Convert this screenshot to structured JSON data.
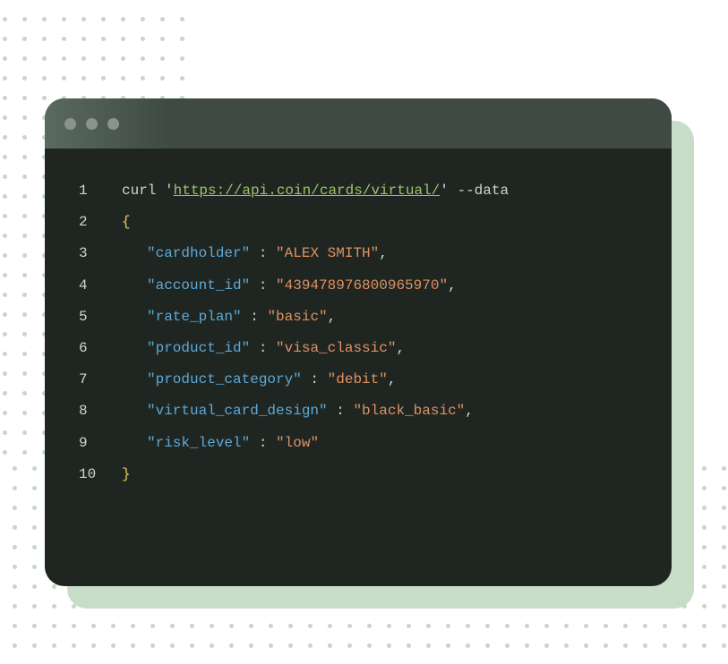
{
  "code": {
    "command": "curl",
    "url": "https://api.coin/cards/virtual/",
    "flag": "--data",
    "open_brace": "{",
    "close_brace": "}",
    "lines": [
      {
        "n": "1"
      },
      {
        "n": "2"
      },
      {
        "n": "3"
      },
      {
        "n": "4"
      },
      {
        "n": "5"
      },
      {
        "n": "6"
      },
      {
        "n": "7"
      },
      {
        "n": "8"
      },
      {
        "n": "9"
      },
      {
        "n": "10"
      }
    ],
    "entries": [
      {
        "key": "\"cardholder\"",
        "val": "\"ALEX SMITH\"",
        "comma": ","
      },
      {
        "key": "\"account_id\"",
        "val": "\"439478976800965970\"",
        "comma": ","
      },
      {
        "key": "\"rate_plan\"",
        "val": "\"basic\"",
        "comma": ","
      },
      {
        "key": "\"product_id\"",
        "val": "\"visa_classic\"",
        "comma": ","
      },
      {
        "key": "\"product_category\"",
        "val": "\"debit\"",
        "comma": ","
      },
      {
        "key": "\"virtual_card_design\"",
        "val": "\"black_basic\"",
        "comma": ","
      },
      {
        "key": "\"risk_level\"",
        "val": "\"low\"",
        "comma": ""
      }
    ]
  }
}
